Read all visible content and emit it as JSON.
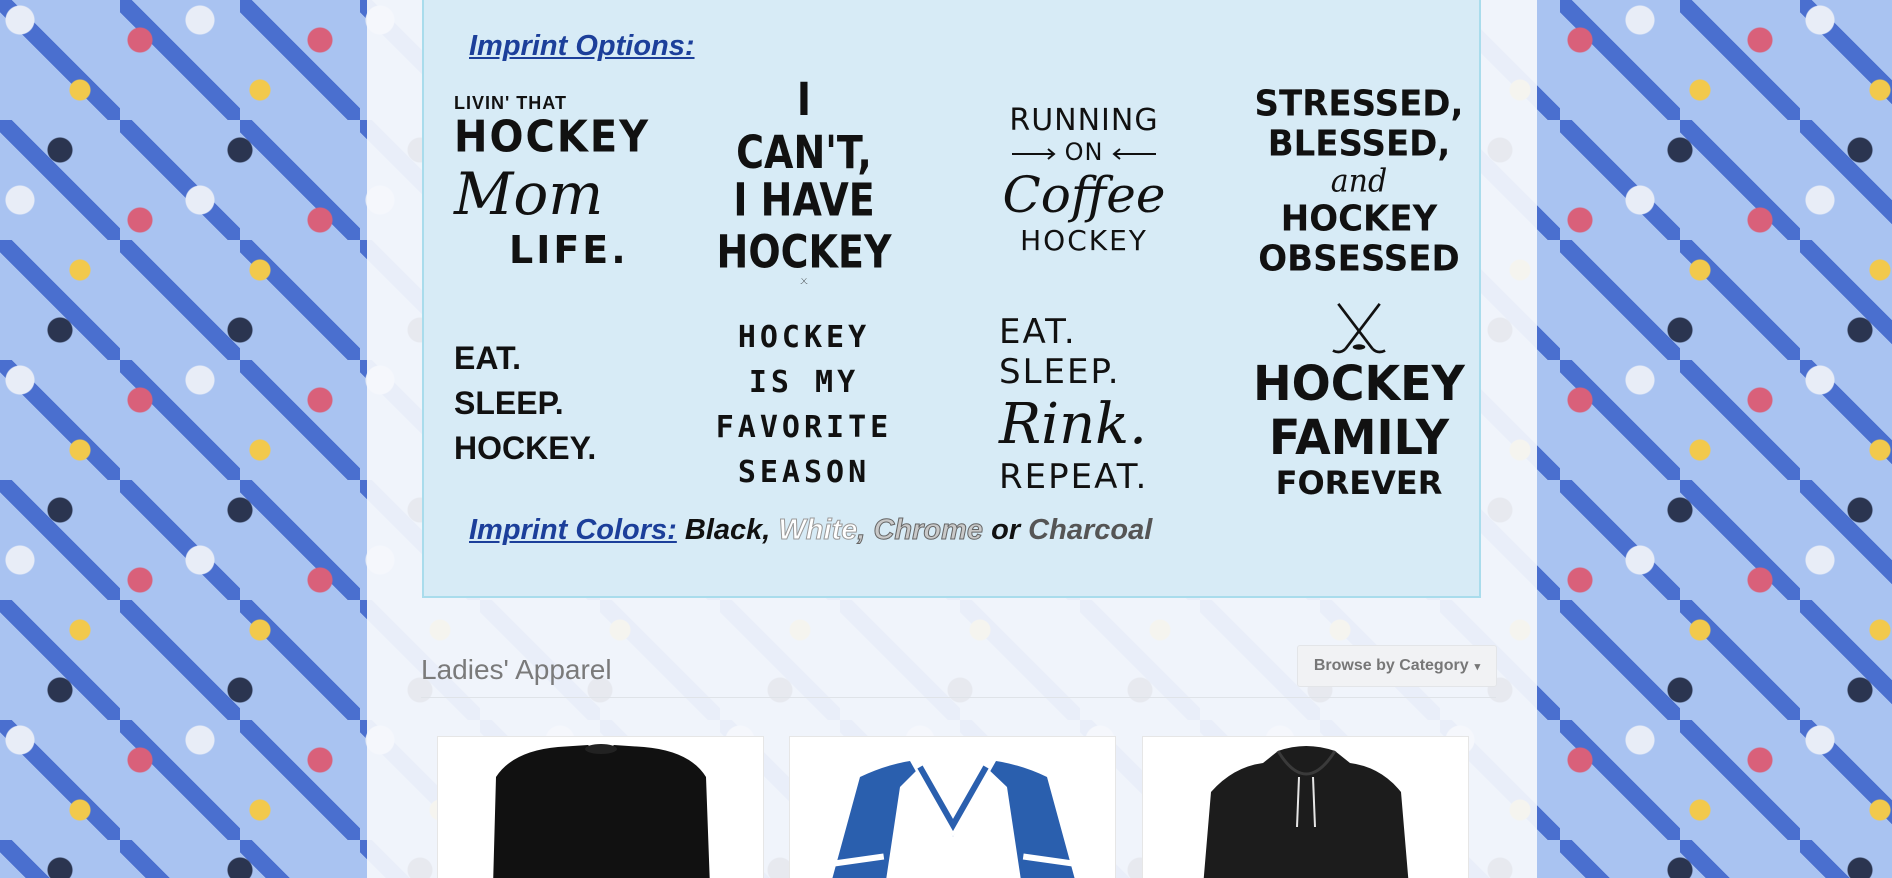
{
  "imprint": {
    "heading": "Imprint Options:",
    "designs": [
      {
        "lines": [
          "LIVIN' THAT",
          "HOCKEY",
          "Mom",
          "LIFE."
        ]
      },
      {
        "lines": [
          "I CAN'T,",
          "I HAVE",
          "HOCKEY"
        ]
      },
      {
        "lines": [
          "RUNNING",
          "ON",
          "Coffee",
          "HOCKEY"
        ]
      },
      {
        "lines": [
          "STRESSED,",
          "BLESSED,",
          "and",
          "HOCKEY",
          "OBSESSED"
        ]
      },
      {
        "lines": [
          "EAT.",
          "SLEEP.",
          "HOCKEY."
        ]
      },
      {
        "lines": [
          "HOCKEY",
          "IS MY",
          "FAVORITE",
          "SEASON"
        ]
      },
      {
        "lines": [
          "EAT.",
          "SLEEP.",
          "Rink.",
          "REPEAT."
        ]
      },
      {
        "lines": [
          "HOCKEY",
          "FAMILY",
          "FOREVER"
        ]
      }
    ],
    "colors_label": "Imprint Colors:",
    "colors": {
      "black": "Black,",
      "white": "White",
      "chrome": ", Chrome",
      "or": "or",
      "charcoal": "Charcoal"
    },
    "accent_color": "#1c3f9a"
  },
  "section": {
    "title": "Ladies' Apparel",
    "browse_button": "Browse by Category"
  },
  "products": [
    {
      "name": "black-crewneck-sweatshirt",
      "body_color": "#111111"
    },
    {
      "name": "blue-white-raglan-vneck",
      "body_color": "#2a5fae"
    },
    {
      "name": "black-hooded-sweatshirt",
      "body_color": "#1c1c1c"
    }
  ]
}
